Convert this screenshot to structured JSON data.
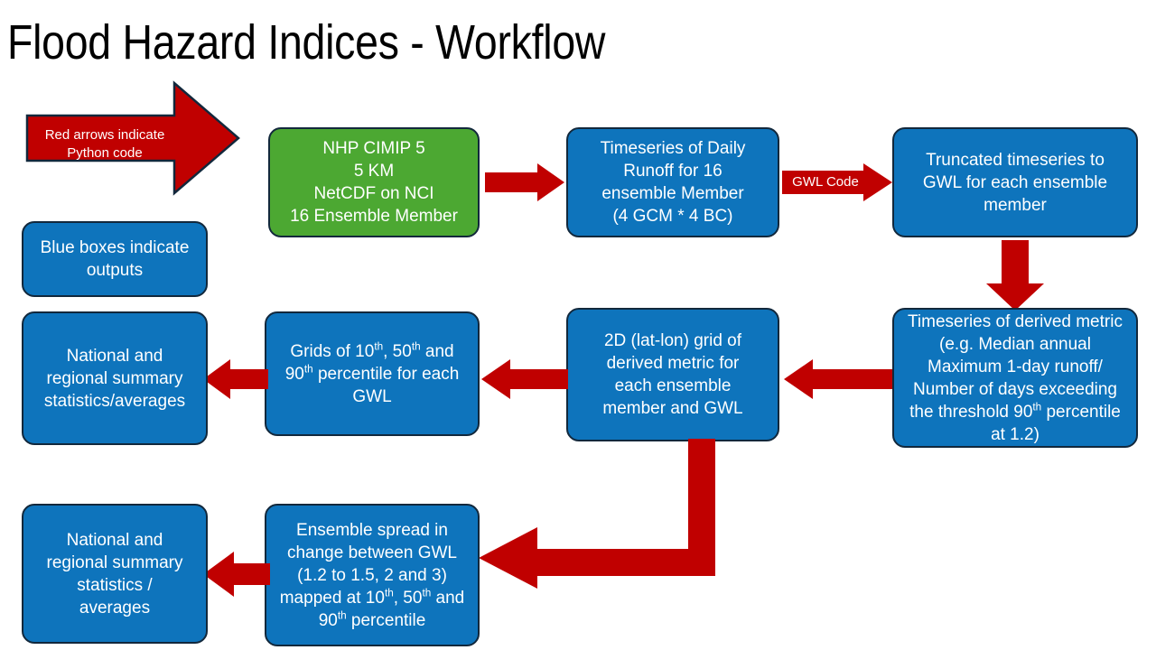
{
  "slide": {
    "title": "Flood Hazard Indices - Workflow",
    "background": "#FFFFFF"
  },
  "colors": {
    "blue_box": "#0E74BC",
    "green_box": "#4CA832",
    "red_arrow": "#C00000",
    "box_border": "#12283C",
    "text": "#FFFFFF",
    "title_text": "#000000"
  },
  "legend": {
    "red_arrow_note": "Red arrows indicate Python code",
    "blue_box_note": "Blue boxes indicate outputs"
  },
  "nodes": {
    "source_data": {
      "lines": [
        "NHP CIMIP 5",
        "5 KM",
        "NetCDF on NCI",
        "16 Ensemble Member"
      ],
      "color": "green"
    },
    "daily_runoff": {
      "lines": [
        "Timeseries of Daily",
        "Runoff for 16",
        "ensemble Member",
        "(4 GCM * 4 BC)"
      ],
      "color": "blue"
    },
    "truncated_timeseries": {
      "lines": [
        "Truncated timeseries to",
        "GWL for each ensemble",
        "member"
      ],
      "color": "blue"
    },
    "derived_metric": {
      "lines": [
        "Timeseries of derived",
        "metric (e.g. Median",
        "annual Maximum 1-day",
        "runoff/ Number of days",
        "exceeding the threshold",
        "90th percentile at 1.2)"
      ],
      "color": "blue",
      "html": "Timeseries of derived metric (e.g. Median annual Maximum 1-day runoff/ Number of days exceeding the threshold 90<sup>th</sup> percentile at 1.2)"
    },
    "grid_2d": {
      "lines": [
        "2D (lat-lon) grid of",
        "derived metric for",
        "each ensemble",
        "member and GWL"
      ],
      "color": "blue"
    },
    "percentile_grids": {
      "lines": [
        "Grids of 10th, 50th and",
        "90th percentile for",
        "each GWL"
      ],
      "color": "blue",
      "html": "Grids of 10<sup>th</sup>, 50<sup>th</sup> and 90<sup>th</sup> percentile for each GWL"
    },
    "summary_top": {
      "lines": [
        "National and",
        "regional summary",
        "statistics/averages"
      ],
      "color": "blue"
    },
    "ensemble_spread": {
      "lines": [
        "Ensemble spread in",
        "change between",
        "GWL (1.2 to 1.5, 2",
        "and 3) mapped at",
        "10th, 50th and 90th",
        "percentile"
      ],
      "color": "blue",
      "html": "Ensemble spread in change between GWL (1.2 to 1.5, 2 and 3) mapped at 10<sup>th</sup>, 50<sup>th</sup> and 90<sup>th</sup> percentile"
    },
    "summary_bottom": {
      "lines": [
        "National and",
        "regional summary",
        "statistics /",
        "averages"
      ],
      "color": "blue"
    }
  },
  "arrows": {
    "gwl_code": "GWL Code"
  }
}
